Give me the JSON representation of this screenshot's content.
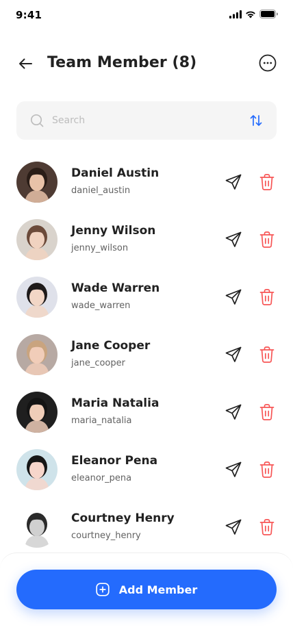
{
  "status_bar": {
    "time": "9:41"
  },
  "header": {
    "title": "Team Member (8)"
  },
  "search": {
    "placeholder": "Search"
  },
  "members": [
    {
      "name": "Daniel Austin",
      "username": "daniel_austin",
      "avatar_bg": "#4e3b33",
      "skin": "#e8c2a8",
      "hair": "#2a1d17"
    },
    {
      "name": "Jenny Wilson",
      "username": "jenny_wilson",
      "avatar_bg": "#d9d3cc",
      "skin": "#f0d2c0",
      "hair": "#6b4a3a"
    },
    {
      "name": "Wade Warren",
      "username": "wade_warren",
      "avatar_bg": "#dfe1ea",
      "skin": "#f2d6c6",
      "hair": "#1e1a1a"
    },
    {
      "name": "Jane Cooper",
      "username": "jane_cooper",
      "avatar_bg": "#b7a9a3",
      "skin": "#f1cdb9",
      "hair": "#c9a47f"
    },
    {
      "name": "Maria Natalia",
      "username": "maria_natalia",
      "avatar_bg": "#1f1f1f",
      "skin": "#efcdb8",
      "hair": "#141414"
    },
    {
      "name": "Eleanor Pena",
      "username": "eleanor_pena",
      "avatar_bg": "#cfe3ea",
      "skin": "#f6d6cb",
      "hair": "#161616"
    },
    {
      "name": "Courtney Henry",
      "username": "courtney_henry",
      "avatar_bg": "#ffffff",
      "skin": "#d0d0d0",
      "hair": "#2b2b2b"
    }
  ],
  "actions": {
    "add_member_label": "Add Member"
  },
  "colors": {
    "primary": "#246bfd",
    "danger": "#f75555",
    "text": "#212121",
    "muted": "#616161"
  },
  "icons": {
    "back": "arrow-left-icon",
    "more": "more-circle-icon",
    "search": "search-icon",
    "sort": "sort-arrows-icon",
    "send": "send-icon",
    "delete": "trash-icon",
    "add": "plus-square-icon"
  }
}
